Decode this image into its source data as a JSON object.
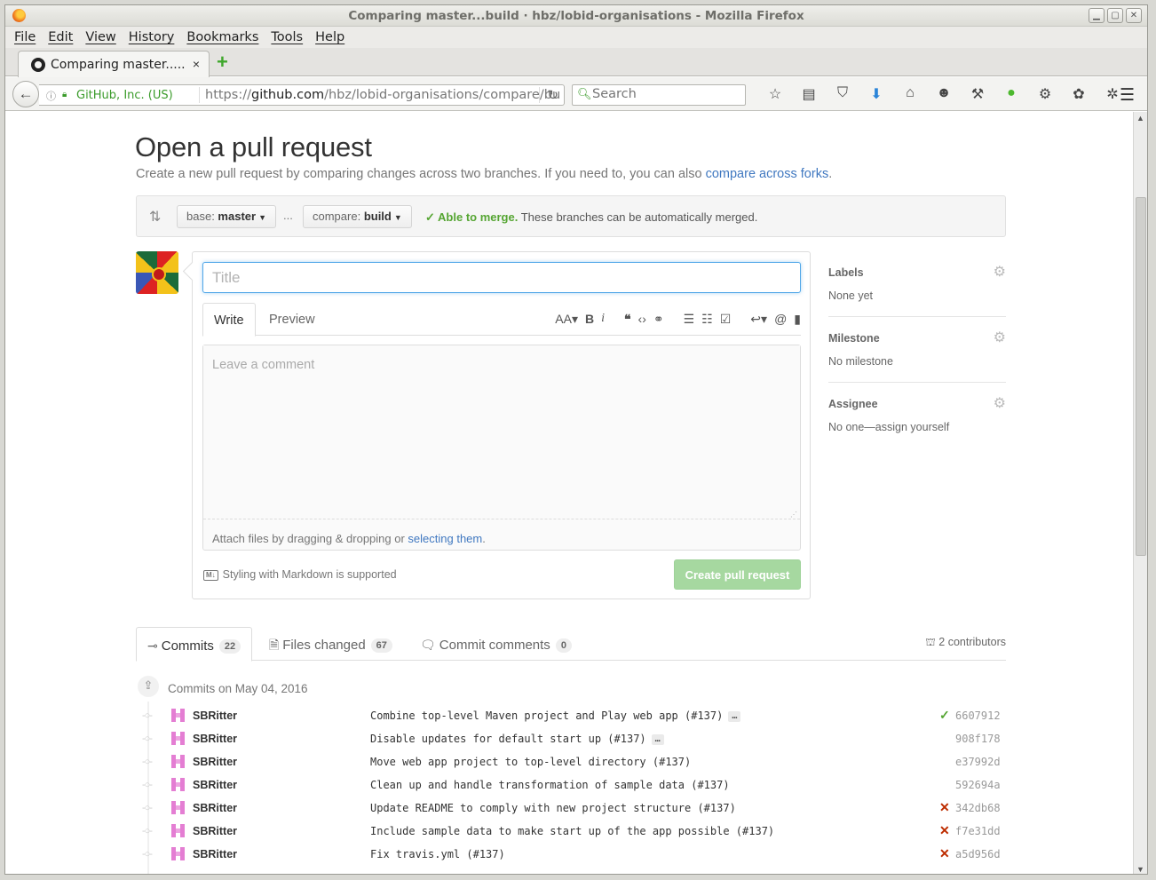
{
  "window": {
    "title": "Comparing master...build · hbz/lobid-organisations - Mozilla Firefox"
  },
  "menubar": [
    "File",
    "Edit",
    "View",
    "History",
    "Bookmarks",
    "Tools",
    "Help"
  ],
  "tab": {
    "label": "Comparing master.....",
    "close": "×",
    "new_tab": "+"
  },
  "urlbar": {
    "identity": "GitHub, Inc. (US)",
    "url_prefix": "https://",
    "url_host": "github.com",
    "url_path": "/hbz/lobid-organisations/compare/bu"
  },
  "search": {
    "placeholder": "Search"
  },
  "page": {
    "heading": "Open a pull request",
    "subtitle_text": "Create a new pull request by comparing changes across two branches. If you need to, you can also ",
    "subtitle_link": "compare across forks",
    "subtitle_end": ".",
    "base_label": "base: ",
    "base_value": "master",
    "compare_label": "compare: ",
    "compare_value": "build",
    "dots": "...",
    "merge_ok": "Able to merge.",
    "merge_text": " These branches can be automatically merged.",
    "title_placeholder": "Title",
    "write_tab": "Write",
    "preview_tab": "Preview",
    "comment_placeholder": "Leave a comment",
    "attach_text": "Attach files by dragging & dropping or ",
    "attach_link": "selecting them",
    "attach_end": ".",
    "markdown_note": "Styling with Markdown is supported",
    "markdown_badge": "M↓",
    "create_button": "Create pull request"
  },
  "sidebar": [
    {
      "heading": "Labels",
      "value": "None yet"
    },
    {
      "heading": "Milestone",
      "value": "No milestone"
    },
    {
      "heading": "Assignee",
      "value": "No one—assign yourself"
    }
  ],
  "commit_tabs": {
    "commits_label": "Commits",
    "commits_count": "22",
    "files_label": "Files changed",
    "files_count": "67",
    "comments_label": "Commit comments",
    "comments_count": "0",
    "contributors": "2 contributors"
  },
  "commit_group": {
    "title": "Commits on May 04, 2016"
  },
  "commits": [
    {
      "author": "SBRitter",
      "message": "Combine top-level Maven project and Play web app (#137)",
      "ellipsis": "…",
      "status": "ok",
      "sha": "6607912"
    },
    {
      "author": "SBRitter",
      "message": "Disable updates for default start up (#137)",
      "ellipsis": "…",
      "status": "",
      "sha": "908f178"
    },
    {
      "author": "SBRitter",
      "message": "Move web app project to top-level directory (#137)",
      "ellipsis": "",
      "status": "",
      "sha": "e37992d"
    },
    {
      "author": "SBRitter",
      "message": "Clean up and handle transformation of sample data (#137)",
      "ellipsis": "",
      "status": "",
      "sha": "592694a"
    },
    {
      "author": "SBRitter",
      "message": "Update README to comply with new project structure (#137)",
      "ellipsis": "",
      "status": "fail",
      "sha": "342db68"
    },
    {
      "author": "SBRitter",
      "message": "Include sample data to make start up of the app possible (#137)",
      "ellipsis": "",
      "status": "fail",
      "sha": "f7e31dd"
    },
    {
      "author": "SBRitter",
      "message": "Fix travis.yml (#137)",
      "ellipsis": "",
      "status": "fail",
      "sha": "a5d956d"
    }
  ],
  "colors": {
    "link": "#4078c0",
    "success": "#55a532",
    "failure": "#bd2c00",
    "create_button_disabled": "#a6d8a0"
  }
}
